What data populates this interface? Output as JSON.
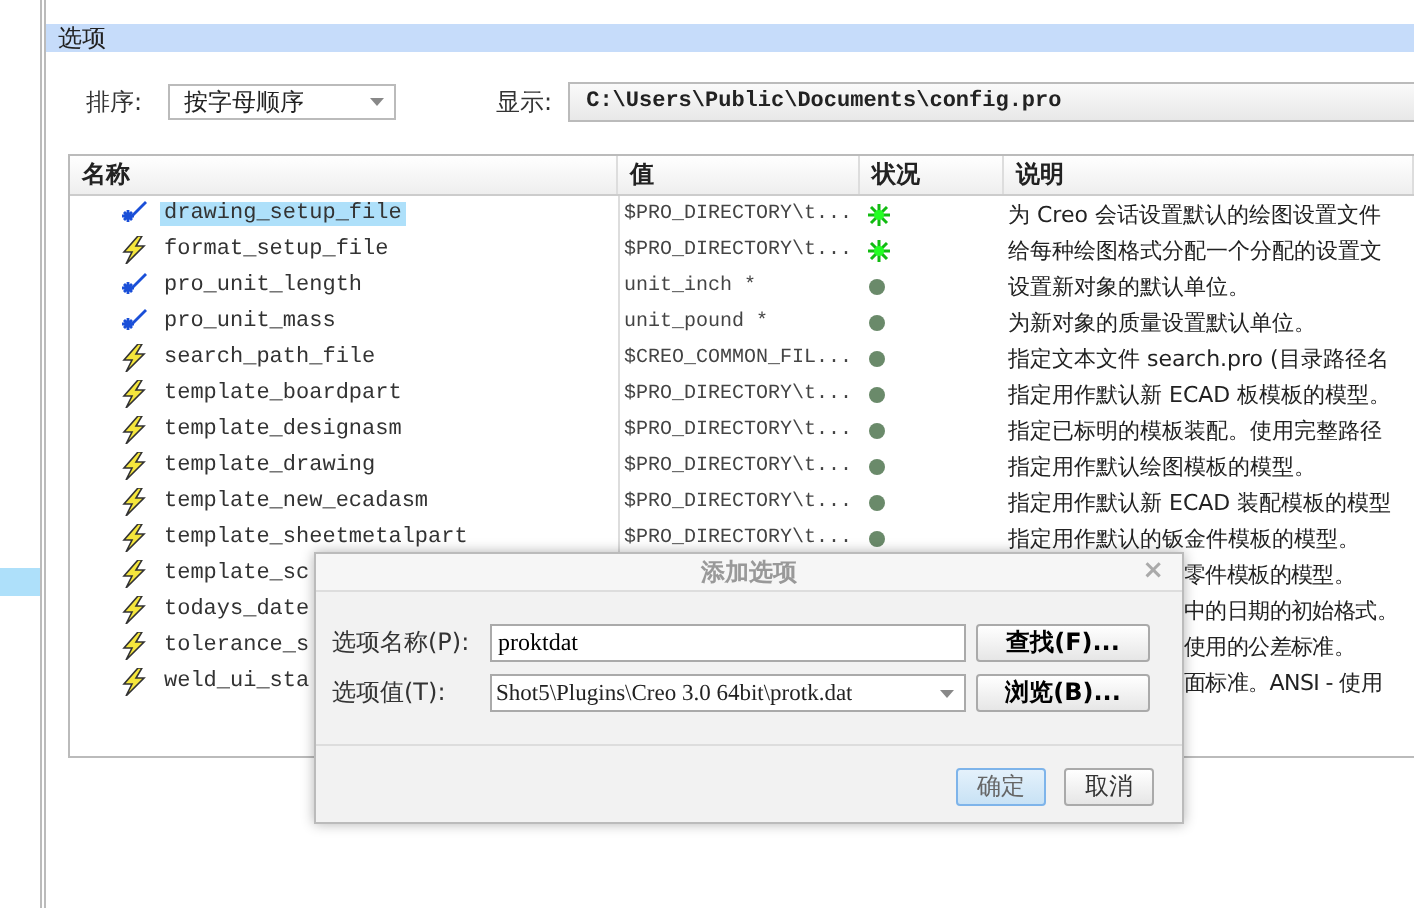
{
  "section_title": "选项",
  "sort": {
    "label": "排序:",
    "value": "按字母顺序"
  },
  "show": {
    "label": "显示:",
    "value": "C:\\Users\\Public\\Documents\\config.pro"
  },
  "table": {
    "columns": [
      "名称",
      "值",
      "状况",
      "说明"
    ],
    "rows": [
      {
        "kind": "full",
        "modified": true,
        "name": "drawing_setup_file",
        "value": "$PRO_DIRECTORY\\t...",
        "current": true,
        "description": "为 Creo 会话设置默认的绘图设置文件",
        "selected": true
      },
      {
        "kind": "full",
        "modified": false,
        "name": "format_setup_file",
        "value": "$PRO_DIRECTORY\\t...",
        "current": true,
        "description": "给每种绘图格式分配一个分配的设置文",
        "selected": false
      },
      {
        "kind": "full",
        "modified": true,
        "name": "pro_unit_length",
        "value": "unit_inch *",
        "current": false,
        "description": "设置新对象的默认单位。",
        "selected": false
      },
      {
        "kind": "full",
        "modified": true,
        "name": "pro_unit_mass",
        "value": "unit_pound *",
        "current": false,
        "description": "为新对象的质量设置默认单位。",
        "selected": false
      },
      {
        "kind": "full",
        "modified": false,
        "name": "search_path_file",
        "value": "$CREO_COMMON_FIL...",
        "current": false,
        "description": "指定文本文件 search.pro (目录路径名",
        "selected": false
      },
      {
        "kind": "full",
        "modified": false,
        "name": "template_boardpart",
        "value": "$PRO_DIRECTORY\\t...",
        "current": false,
        "description": "指定用作默认新 ECAD 板模板的模型。",
        "selected": false
      },
      {
        "kind": "full",
        "modified": false,
        "name": "template_designasm",
        "value": "$PRO_DIRECTORY\\t...",
        "current": false,
        "description": "指定已标明的模板装配。使用完整路径",
        "selected": false
      },
      {
        "kind": "full",
        "modified": false,
        "name": "template_drawing",
        "value": "$PRO_DIRECTORY\\t...",
        "current": false,
        "description": "指定用作默认绘图模板的模型。",
        "selected": false
      },
      {
        "kind": "full",
        "modified": false,
        "name": "template_new_ecadasm",
        "value": "$PRO_DIRECTORY\\t...",
        "current": false,
        "description": "指定用作默认新 ECAD 装配模板的模型",
        "selected": false
      },
      {
        "kind": "full",
        "modified": false,
        "name": "template_sheetmetalpart",
        "value": "$PRO_DIRECTORY\\t...",
        "current": false,
        "description": "指定用作默认的钣金件模板的模型。",
        "selected": false
      },
      {
        "kind": "covered",
        "modified": false,
        "name": "template_sc",
        "description": "零件模板的模型。",
        "selected": false
      },
      {
        "kind": "covered",
        "modified": false,
        "name": "todays_date",
        "description": "中的日期的初始格式。",
        "selected": false
      },
      {
        "kind": "covered",
        "modified": false,
        "name": "tolerance_s",
        "description": "使用的公差标准。",
        "selected": false
      },
      {
        "kind": "covered",
        "modified": false,
        "name": "weld_ui_sta",
        "description": "面标准。ANSI - 使用",
        "selected": false
      }
    ]
  },
  "dialog": {
    "title": "添加选项",
    "close": "×",
    "name_label": "选项名称(P):",
    "name_value": "proktdat",
    "find_button": "查找(F)...",
    "value_label": "选项值(T):",
    "value_value": "Shot5\\Plugins\\Creo 3.0 64bit\\protk.dat",
    "browse_button": "浏览(B)...",
    "ok_button": "确定",
    "cancel_button": "取消"
  }
}
